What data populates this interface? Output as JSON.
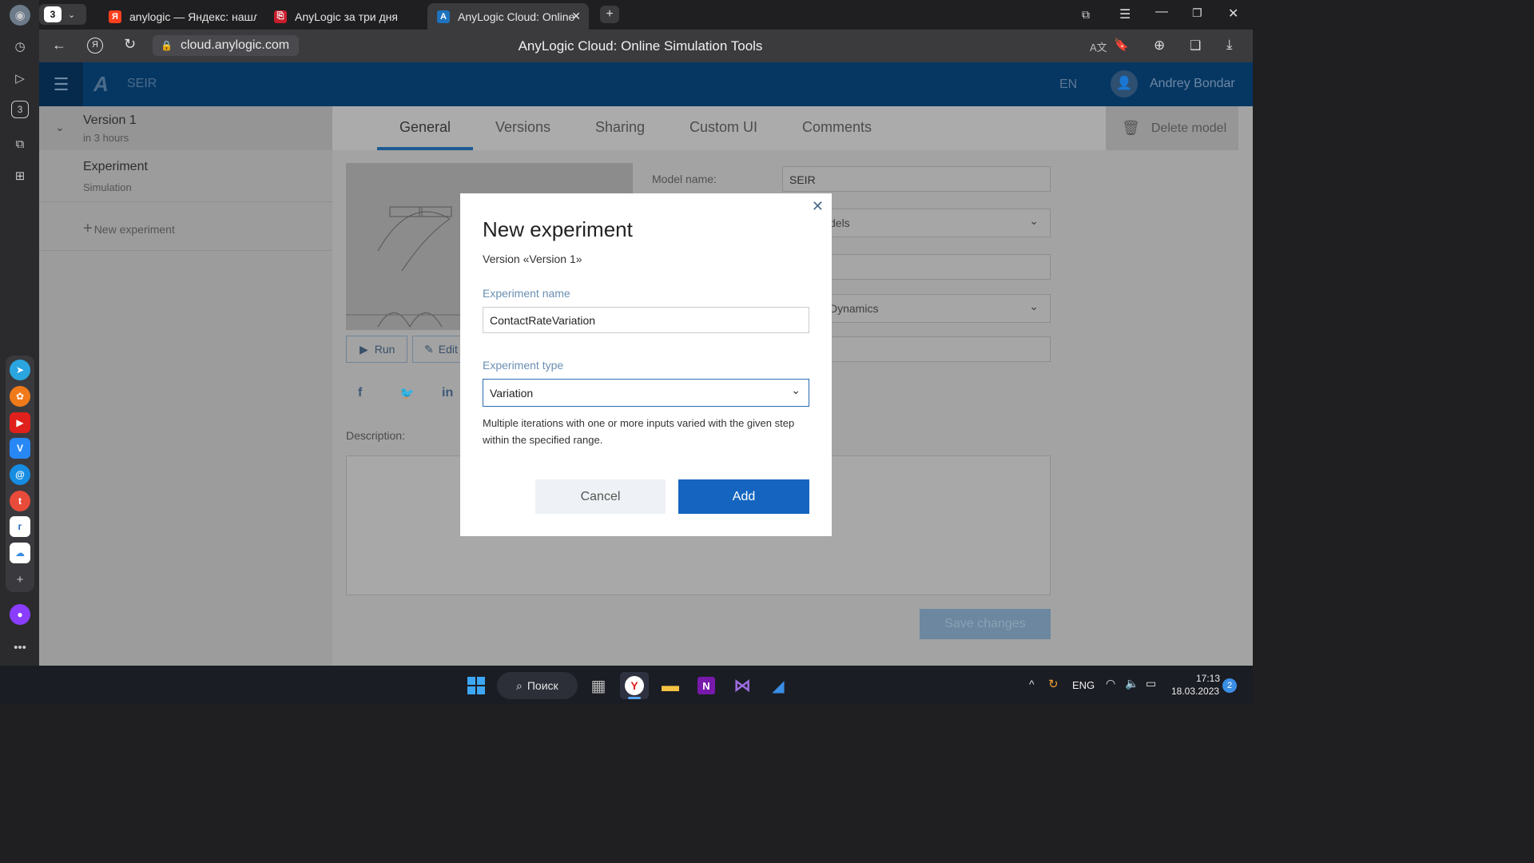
{
  "browser": {
    "tab_count_badge": "3",
    "tabs": [
      {
        "label": "anylogic — Яндекс: нашлось",
        "icon": "yandex-icon"
      },
      {
        "label": "AnyLogic за три дня",
        "icon": "pdf-icon"
      },
      {
        "label": "AnyLogic Cloud: Online",
        "icon": "anylogic-icon"
      }
    ],
    "url": "cloud.anylogic.com",
    "page_title": "AnyLogic Cloud: Online Simulation Tools"
  },
  "app": {
    "model_title": "SEIR",
    "language": "EN",
    "user_name": "Andrey Bondar"
  },
  "left_panel": {
    "version_title": "Version 1",
    "version_time": "in 3 hours",
    "experiment_title": "Experiment",
    "experiment_type": "Simulation",
    "new_experiment": "New experiment"
  },
  "main": {
    "tabs": [
      "General",
      "Versions",
      "Sharing",
      "Custom UI",
      "Comments"
    ],
    "delete_label": "Delete model",
    "model_name_label": "Model name:",
    "model_name_value": "SEIR",
    "field_partial_1": "dels",
    "field_partial_2": "Dynamics",
    "run_label": "Run",
    "edit_label": "Edit",
    "description_label": "Description:",
    "save_label": "Save changes"
  },
  "modal": {
    "title": "New experiment",
    "subtitle": "Version «Version 1»",
    "name_label": "Experiment name",
    "name_value": "ContactRateVariation",
    "type_label": "Experiment type",
    "type_value": "Variation",
    "type_description": "Multiple iterations with one or more inputs varied with the given step within the specified range.",
    "cancel_label": "Cancel",
    "add_label": "Add"
  },
  "taskbar": {
    "search_label": "Поиск",
    "lang": "ENG",
    "time": "17:13",
    "date": "18.03.2023",
    "notifications": "2"
  },
  "colors": {
    "app_header": "#063763",
    "primary_button": "#1565c0",
    "active_tab": "#1d5a91"
  }
}
